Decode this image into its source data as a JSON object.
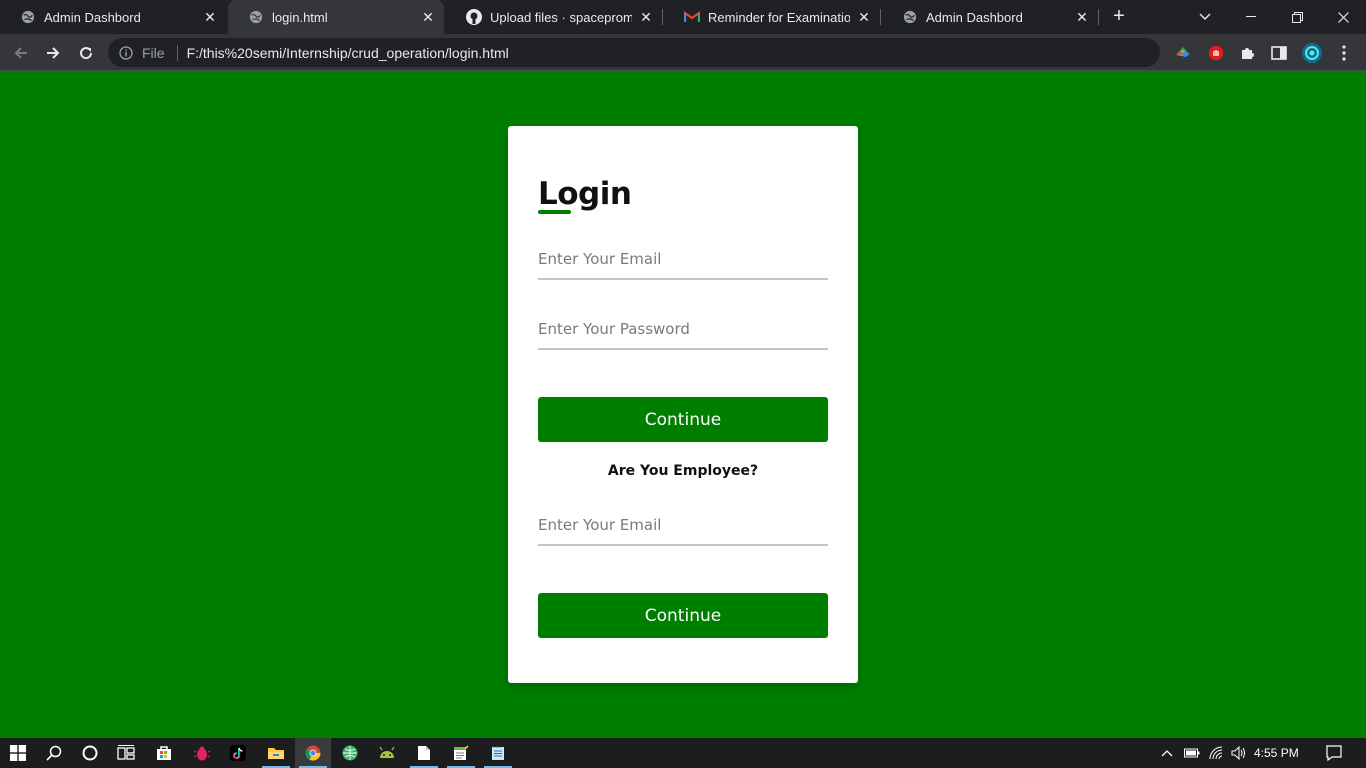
{
  "browser": {
    "tabs": [
      {
        "title": "Admin Dashbord",
        "icon": "globe-icon"
      },
      {
        "title": "login.html",
        "icon": "globe-icon",
        "active": true
      },
      {
        "title": "Upload files · spacepromin/O",
        "icon": "github-icon"
      },
      {
        "title": "Reminder for Examination - a",
        "icon": "gmail-icon"
      },
      {
        "title": "Admin Dashbord",
        "icon": "globe-icon"
      }
    ],
    "address_bar": {
      "scheme_label": "File",
      "url": "F:/this%20semi/Internship/crud_operation/login.html"
    }
  },
  "login": {
    "title": "Login",
    "email_placeholder": "Enter Your Email",
    "password_placeholder": "Enter Your Password",
    "continue_label": "Continue",
    "employee_question": "Are You Employee?",
    "employee_email_placeholder": "Enter Your Email",
    "employee_continue_label": "Continue"
  },
  "taskbar": {
    "time": "4:55 PM"
  },
  "colors": {
    "page_background": "#007e00",
    "accent": "#007e00",
    "card": "#ffffff"
  }
}
